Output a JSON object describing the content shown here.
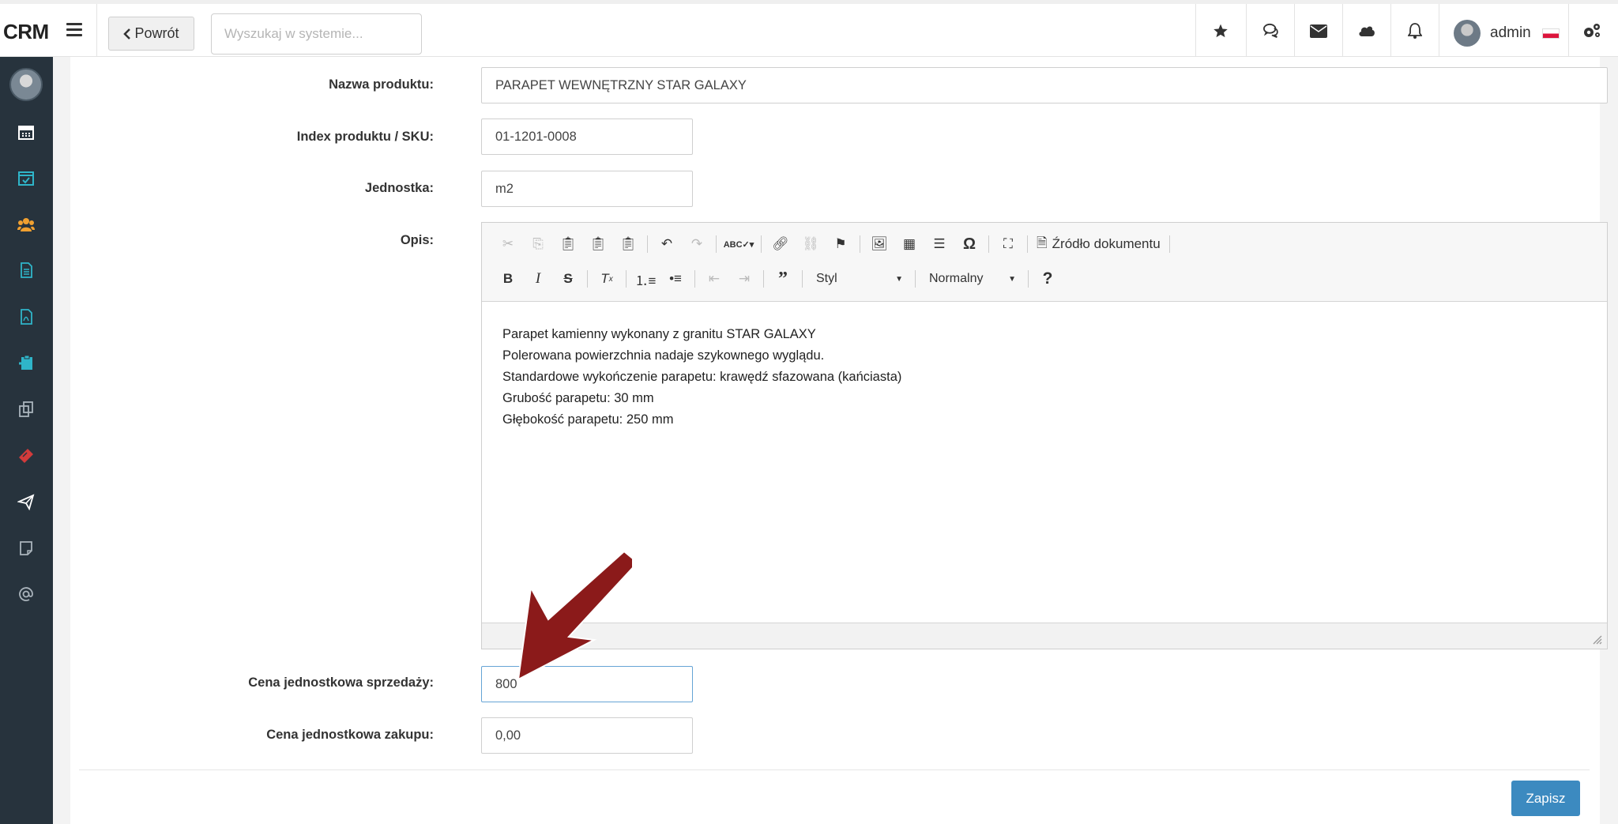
{
  "topbar": {
    "brand": "CRM",
    "back_label": "Powrót",
    "search_placeholder": "Wyszukaj w systemie...",
    "username": "admin",
    "icons": [
      "star-icon",
      "chat-icon",
      "envelope-icon",
      "cloud-icon",
      "bell-icon",
      "user-avatar",
      "gears-icon"
    ]
  },
  "sidebar": {
    "items": [
      {
        "icon": "calendar-icon",
        "color": "#ffffff"
      },
      {
        "icon": "calendar-check-icon",
        "color": "#2fb5c9"
      },
      {
        "icon": "users-icon",
        "color": "#f0a030"
      },
      {
        "icon": "document-icon",
        "color": "#2fb5c9"
      },
      {
        "icon": "pdf-icon",
        "color": "#2fb5c9"
      },
      {
        "icon": "clipboard-icon",
        "color": "#2fb5c9"
      },
      {
        "icon": "copy-icon",
        "color": "#aab4bc"
      },
      {
        "icon": "ticket-icon",
        "color": "#d23b3b"
      },
      {
        "icon": "paper-plane-icon",
        "color": "#ffffff"
      },
      {
        "icon": "note-icon",
        "color": "#aab4bc"
      },
      {
        "icon": "at-icon",
        "color": "#aab4bc"
      }
    ]
  },
  "form": {
    "name_label": "Nazwa produktu:",
    "name_value": "PARAPET WEWNĘTRZNY STAR GALAXY",
    "sku_label": "Index produktu / SKU:",
    "sku_value": "01-1201-0008",
    "unit_label": "Jednostka:",
    "unit_value": "m2",
    "desc_label": "Opis:",
    "sell_price_label": "Cena jednostkowa sprzedaży:",
    "sell_price_value": "800",
    "buy_price_label": "Cena jednostkowa zakupu:",
    "buy_price_value": "0,00",
    "save_label": "Zapisz"
  },
  "editor": {
    "source_label": "Źródło dokumentu",
    "style_label": "Styl",
    "format_label": "Normalny",
    "help_label": "?",
    "lines": [
      "Parapet kamienny wykonany z granitu STAR GALAXY",
      "Polerowana powierzchnia nadaje szykownego wyglądu.",
      "Standardowe wykończenie parapetu: krawędź sfazowana (kańciasta)",
      "Grubość parapetu: 30 mm",
      "Głębokość parapetu: 250 mm"
    ]
  },
  "colors": {
    "sidebar_bg": "#27333d",
    "primary_button": "#3c8ac0",
    "annotation_arrow": "#8b1a1a"
  }
}
